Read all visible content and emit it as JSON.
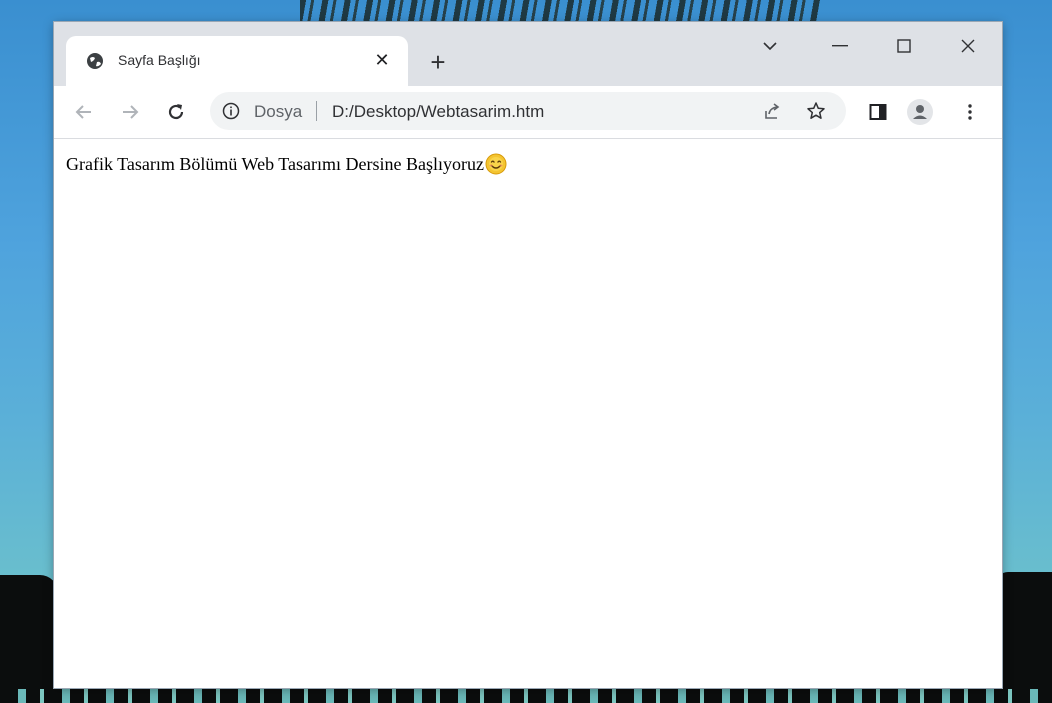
{
  "tab": {
    "title": "Sayfa Başlığı",
    "close_glyph": "✕",
    "new_tab_glyph": "+",
    "favicon": "globe-icon"
  },
  "window_controls": {
    "tab_search": "chevron-down-icon",
    "minimize": "minimize-icon",
    "maximize": "maximize-icon",
    "close": "close-icon"
  },
  "toolbar": {
    "back": "back-arrow-icon",
    "forward": "forward-arrow-icon",
    "reload": "reload-icon",
    "side_panel": "side-panel-icon",
    "profile": "profile-avatar-icon",
    "menu": "kebab-menu-icon"
  },
  "omnibox": {
    "scheme_label": "Dosya",
    "url": "D:/Desktop/Webtasarim.htm",
    "share": "share-icon",
    "bookmark": "star-icon"
  },
  "page": {
    "text": "Grafik Tasarım Bölümü Web Tasarımı Dersine Başlıyoruz",
    "emoji": "smiling-face-emoji"
  },
  "colors": {
    "titlebar": "#dee1e6",
    "omnibox": "#f1f3f4",
    "text": "#000000",
    "icon": "#5f6368"
  }
}
